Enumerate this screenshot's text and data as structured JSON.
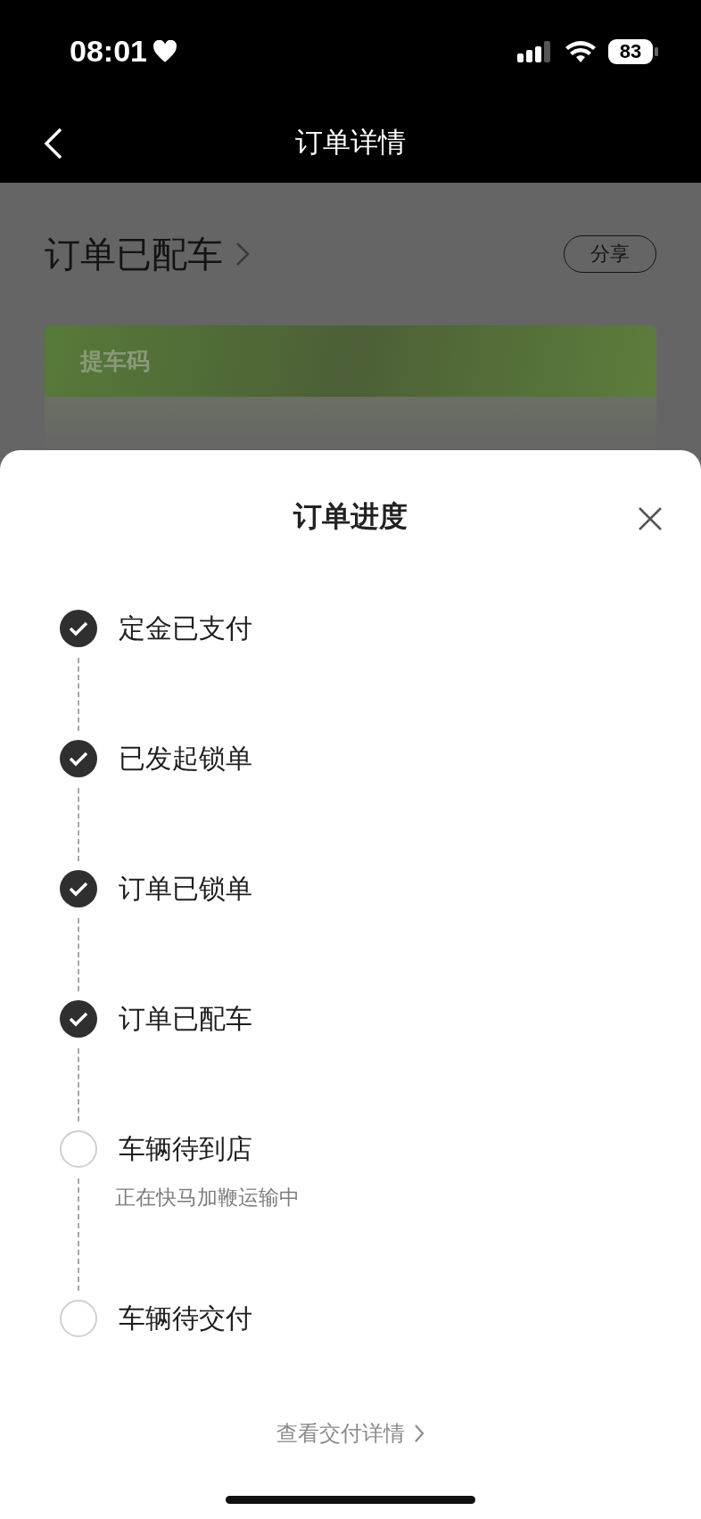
{
  "status_bar": {
    "time": "08:01",
    "battery": "83"
  },
  "nav_bar": {
    "title": "订单详情"
  },
  "background": {
    "order_status": "订单已配车",
    "share_button": "分享",
    "card_title": "提车码"
  },
  "sheet": {
    "title": "订单进度",
    "steps": [
      {
        "label": "定金已支付",
        "checked": true
      },
      {
        "label": "已发起锁单",
        "checked": true
      },
      {
        "label": "订单已锁单",
        "checked": true
      },
      {
        "label": "订单已配车",
        "checked": true
      },
      {
        "label": "车辆待到店",
        "checked": false,
        "note": "正在快马加鞭运输中"
      },
      {
        "label": "车辆待交付",
        "checked": false
      }
    ],
    "footer_link": "查看交付详情"
  }
}
